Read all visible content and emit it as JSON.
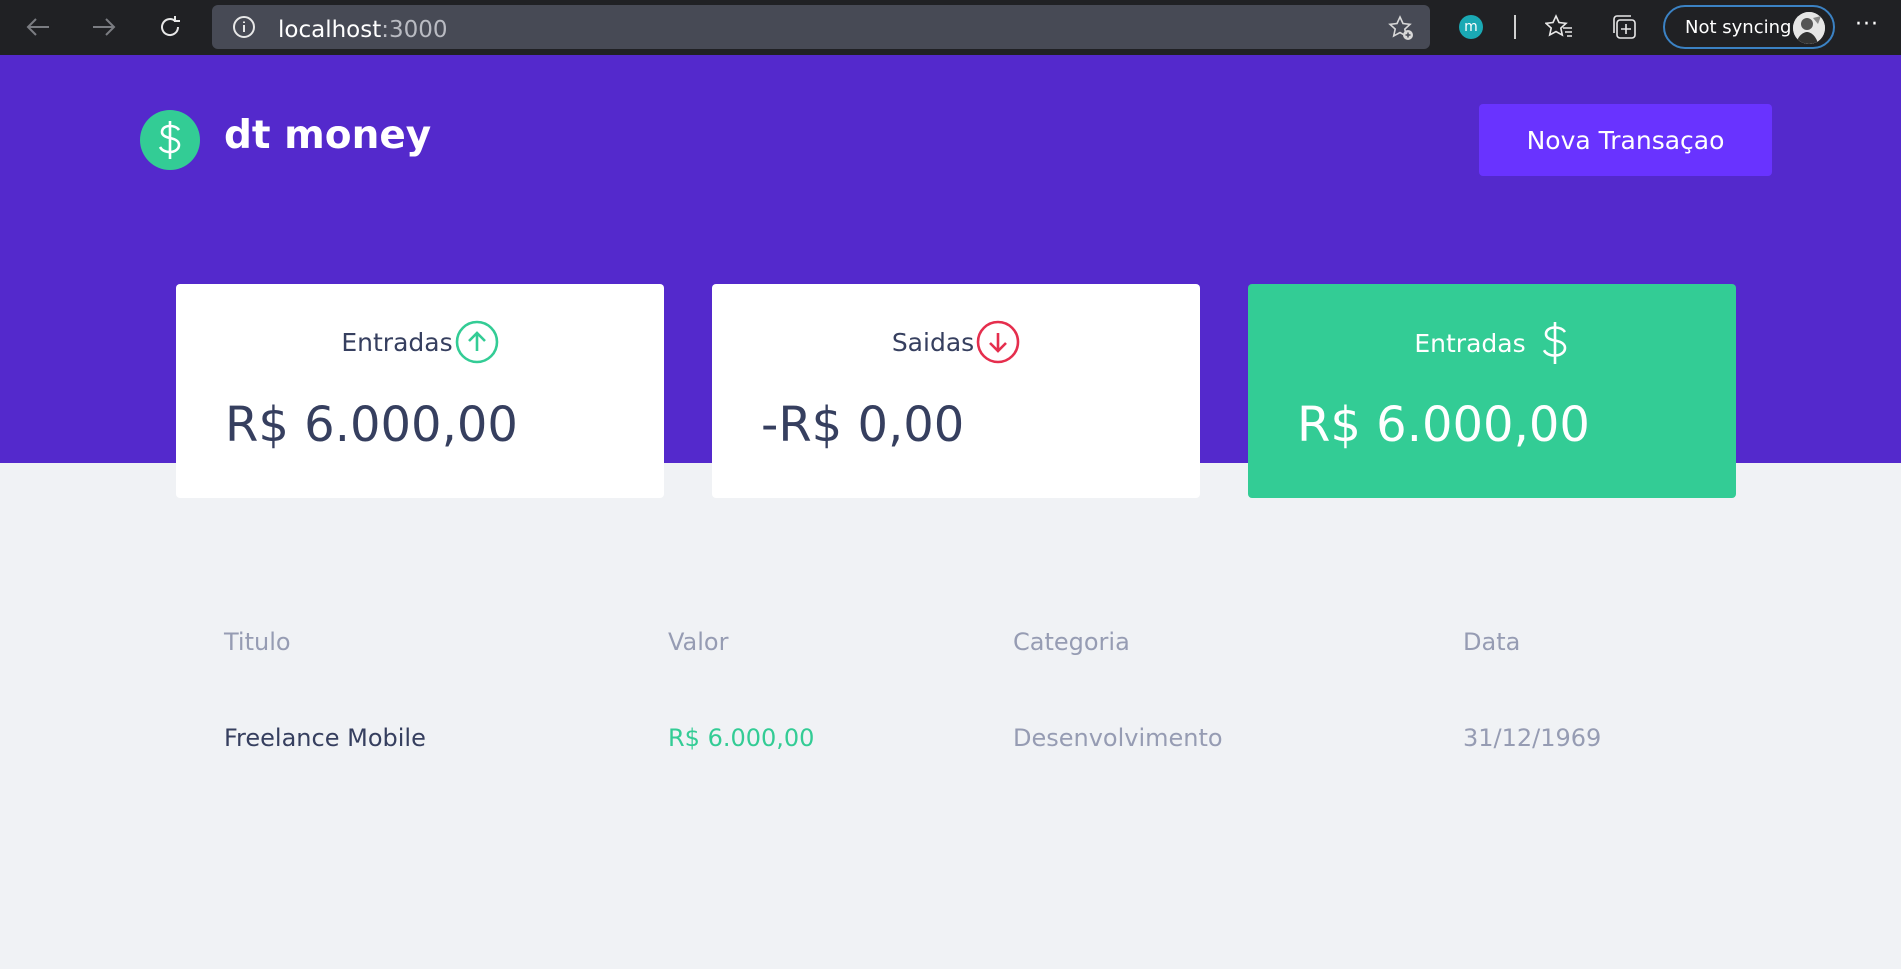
{
  "browser": {
    "url_host": "localhost",
    "url_port": ":3000",
    "profile_initial": "m",
    "sync_label": "Not syncing",
    "more_label": "···",
    "icons": [
      "back-arrow-icon",
      "forward-arrow-icon",
      "refresh-icon",
      "info-icon",
      "favorite-add-icon",
      "favorites-icon",
      "collections-icon"
    ]
  },
  "header": {
    "brand": "dt money",
    "new_transaction_label": "Nova Transaçao",
    "logo_icon": "dollar-icon"
  },
  "summary": {
    "income": {
      "label": "Entradas",
      "amount": "R$ 6.000,00",
      "icon": "arrow-up-circle-icon"
    },
    "outcome": {
      "label": "Saidas",
      "amount": "-R$ 0,00",
      "icon": "arrow-down-circle-icon"
    },
    "total": {
      "label": "Entradas",
      "amount": "R$ 6.000,00",
      "icon": "dollar-icon"
    }
  },
  "table": {
    "headers": {
      "title": "Titulo",
      "value": "Valor",
      "category": "Categoria",
      "date": "Data"
    },
    "rows": [
      {
        "title": "Freelance Mobile",
        "value": "R$ 6.000,00",
        "category": "Desenvolvimento",
        "date": "31/12/1969"
      }
    ]
  },
  "colors": {
    "purple": "#5429cc",
    "button": "#6933ff",
    "green": "#33cc95",
    "red": "#e52e4d",
    "text_title": "#363f5f",
    "text_body": "#969cb3",
    "background": "#f0f2f5"
  }
}
